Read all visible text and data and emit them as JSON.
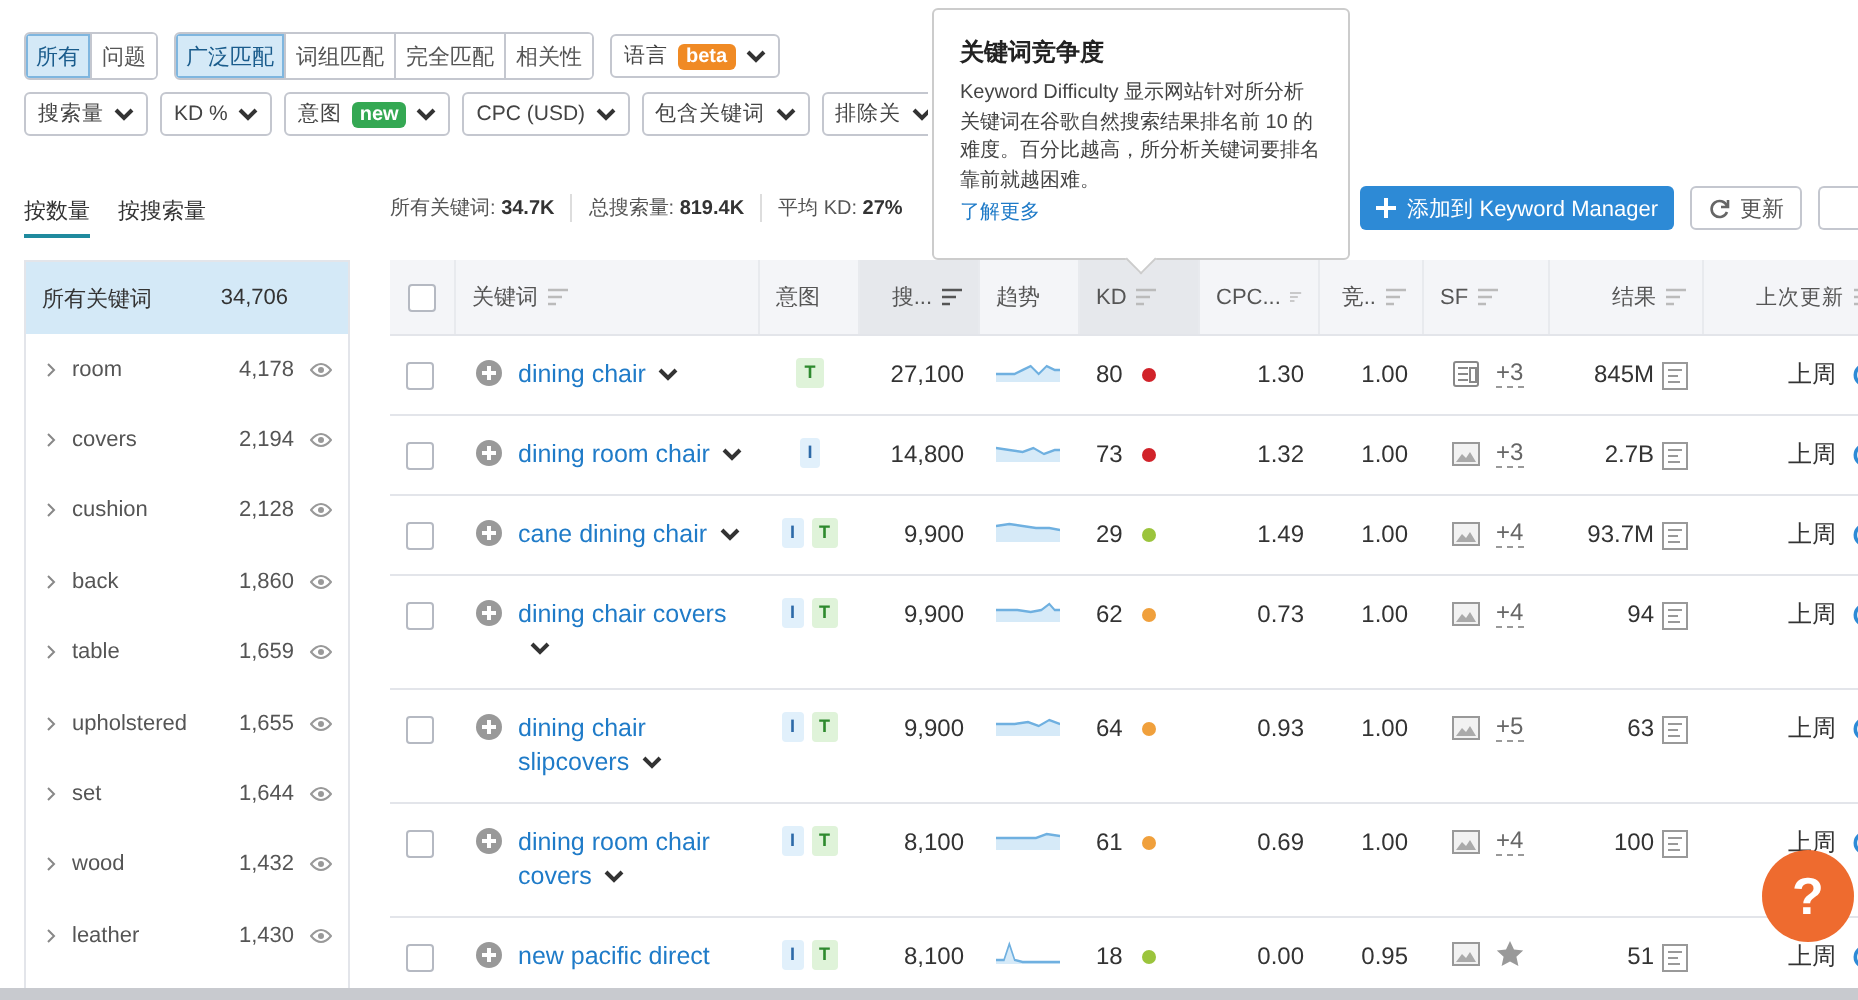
{
  "filters": {
    "group_1": [
      {
        "label": "所有",
        "selected": true
      },
      {
        "label": "问题",
        "selected": false
      }
    ],
    "group_2": [
      {
        "label": "广泛匹配",
        "selected": true
      },
      {
        "label": "词组匹配",
        "selected": false
      },
      {
        "label": "完全匹配",
        "selected": false
      },
      {
        "label": "相关性",
        "selected": false
      }
    ],
    "language": {
      "label": "语言",
      "badge": {
        "text": "beta",
        "kind": "beta"
      }
    },
    "dropdowns": [
      {
        "label": "搜索量"
      },
      {
        "label": "KD %"
      },
      {
        "label": "意图",
        "badge": {
          "text": "new",
          "kind": "new"
        }
      },
      {
        "label": "CPC (USD)"
      },
      {
        "label": "包含关键词"
      },
      {
        "label": "排除关"
      }
    ]
  },
  "sidebar": {
    "tabs": [
      {
        "label": "按数量",
        "selected": true
      },
      {
        "label": "按搜索量",
        "selected": false
      }
    ],
    "header": {
      "label": "所有关键词",
      "count": "34,706"
    },
    "items": [
      {
        "label": "room",
        "count": "4,178"
      },
      {
        "label": "covers",
        "count": "2,194"
      },
      {
        "label": "cushion",
        "count": "2,128"
      },
      {
        "label": "back",
        "count": "1,860"
      },
      {
        "label": "table",
        "count": "1,659"
      },
      {
        "label": "upholstered",
        "count": "1,655"
      },
      {
        "label": "set",
        "count": "1,644"
      },
      {
        "label": "wood",
        "count": "1,432"
      },
      {
        "label": "leather",
        "count": "1,430"
      }
    ]
  },
  "stats": [
    {
      "label": "所有关键词: ",
      "value": "34.7K"
    },
    {
      "label": "总搜索量: ",
      "value": "819.4K"
    },
    {
      "label": "平均 KD: ",
      "value": "27%"
    }
  ],
  "actions": {
    "add_button": "添加到 Keyword Manager",
    "refresh_button": "更新"
  },
  "table": {
    "select_all_checked": false,
    "columns": [
      {
        "label": "关键词",
        "sortable": true,
        "highlighted": false
      },
      {
        "label": "意图",
        "sortable": false,
        "highlighted": false
      },
      {
        "label": "搜...",
        "sortable": true,
        "highlighted": true
      },
      {
        "label": "趋势",
        "sortable": false,
        "highlighted": false
      },
      {
        "label": "KD",
        "sortable": true,
        "highlighted": true
      },
      {
        "label": "CPC...",
        "sortable": true,
        "highlighted": false
      },
      {
        "label": "竞..",
        "sortable": true,
        "highlighted": false
      },
      {
        "label": "SF",
        "sortable": true,
        "highlighted": false
      },
      {
        "label": "结果",
        "sortable": true,
        "highlighted": false
      },
      {
        "label": "上次更新",
        "sortable": true,
        "highlighted": false
      }
    ],
    "rows": [
      {
        "checked": false,
        "keyword": "dining chair",
        "has_menu": true,
        "intents": [
          {
            "label": "T",
            "kind": "transactional"
          }
        ],
        "volume": "27,100",
        "kd": {
          "value": "80",
          "color": "#d1232a"
        },
        "cpc": "1.30",
        "competition": "1.00",
        "sf": [
          {
            "kind": "page"
          }
        ],
        "sf_more": "+3",
        "results": "845M",
        "updated": "上周"
      },
      {
        "checked": false,
        "keyword": "dining room chair",
        "has_menu": true,
        "intents": [
          {
            "label": "I",
            "kind": "informational"
          }
        ],
        "volume": "14,800",
        "kd": {
          "value": "73",
          "color": "#d1232a"
        },
        "cpc": "1.32",
        "competition": "1.00",
        "sf": [
          {
            "kind": "image"
          }
        ],
        "sf_more": "+3",
        "results": "2.7B",
        "updated": "上周"
      },
      {
        "checked": false,
        "keyword": "cane dining chair",
        "has_menu": true,
        "intents": [
          {
            "label": "I",
            "kind": "informational"
          },
          {
            "label": "T",
            "kind": "transactional"
          }
        ],
        "volume": "9,900",
        "kd": {
          "value": "29",
          "color": "#9bc43c"
        },
        "cpc": "1.49",
        "competition": "1.00",
        "sf": [
          {
            "kind": "image"
          }
        ],
        "sf_more": "+4",
        "results": "93.7M",
        "updated": "上周"
      },
      {
        "checked": false,
        "keyword": "dining chair covers",
        "has_menu": true,
        "intents": [
          {
            "label": "I",
            "kind": "informational"
          },
          {
            "label": "T",
            "kind": "transactional"
          }
        ],
        "volume": "9,900",
        "kd": {
          "value": "62",
          "color": "#f0a03c"
        },
        "cpc": "0.73",
        "competition": "1.00",
        "sf": [
          {
            "kind": "image"
          }
        ],
        "sf_more": "+4",
        "results": "94",
        "updated": "上周"
      },
      {
        "checked": false,
        "keyword": "dining chair slipcovers",
        "has_menu": true,
        "intents": [
          {
            "label": "I",
            "kind": "informational"
          },
          {
            "label": "T",
            "kind": "transactional"
          }
        ],
        "volume": "9,900",
        "kd": {
          "value": "64",
          "color": "#f0a03c"
        },
        "cpc": "0.93",
        "competition": "1.00",
        "sf": [
          {
            "kind": "image"
          }
        ],
        "sf_more": "+5",
        "results": "63",
        "updated": "上周"
      },
      {
        "checked": false,
        "keyword": "dining room chair covers",
        "has_menu": true,
        "intents": [
          {
            "label": "I",
            "kind": "informational"
          },
          {
            "label": "T",
            "kind": "transactional"
          }
        ],
        "volume": "8,100",
        "kd": {
          "value": "61",
          "color": "#f0a03c"
        },
        "cpc": "0.69",
        "competition": "1.00",
        "sf": [
          {
            "kind": "image"
          }
        ],
        "sf_more": "+4",
        "results": "100",
        "updated": "上周"
      },
      {
        "checked": false,
        "keyword": "new pacific direct",
        "has_menu": false,
        "intents": [
          {
            "label": "I",
            "kind": "informational"
          },
          {
            "label": "T",
            "kind": "transactional"
          }
        ],
        "volume": "8,100",
        "kd": {
          "value": "18",
          "color": "#9bc43c"
        },
        "cpc": "0.00",
        "competition": "0.95",
        "sf": [
          {
            "kind": "image"
          },
          {
            "kind": "star"
          }
        ],
        "results": "51",
        "updated": "上周"
      }
    ]
  },
  "tooltip": {
    "title": "关键词竞争度",
    "body": "Keyword Difficulty 显示网站针对所分析关键词在谷歌自然搜索结果排名前 10 的难度。百分比越高，所分析关键词要排名靠前就越困难。",
    "link": "了解更多"
  },
  "help_button": "?"
}
